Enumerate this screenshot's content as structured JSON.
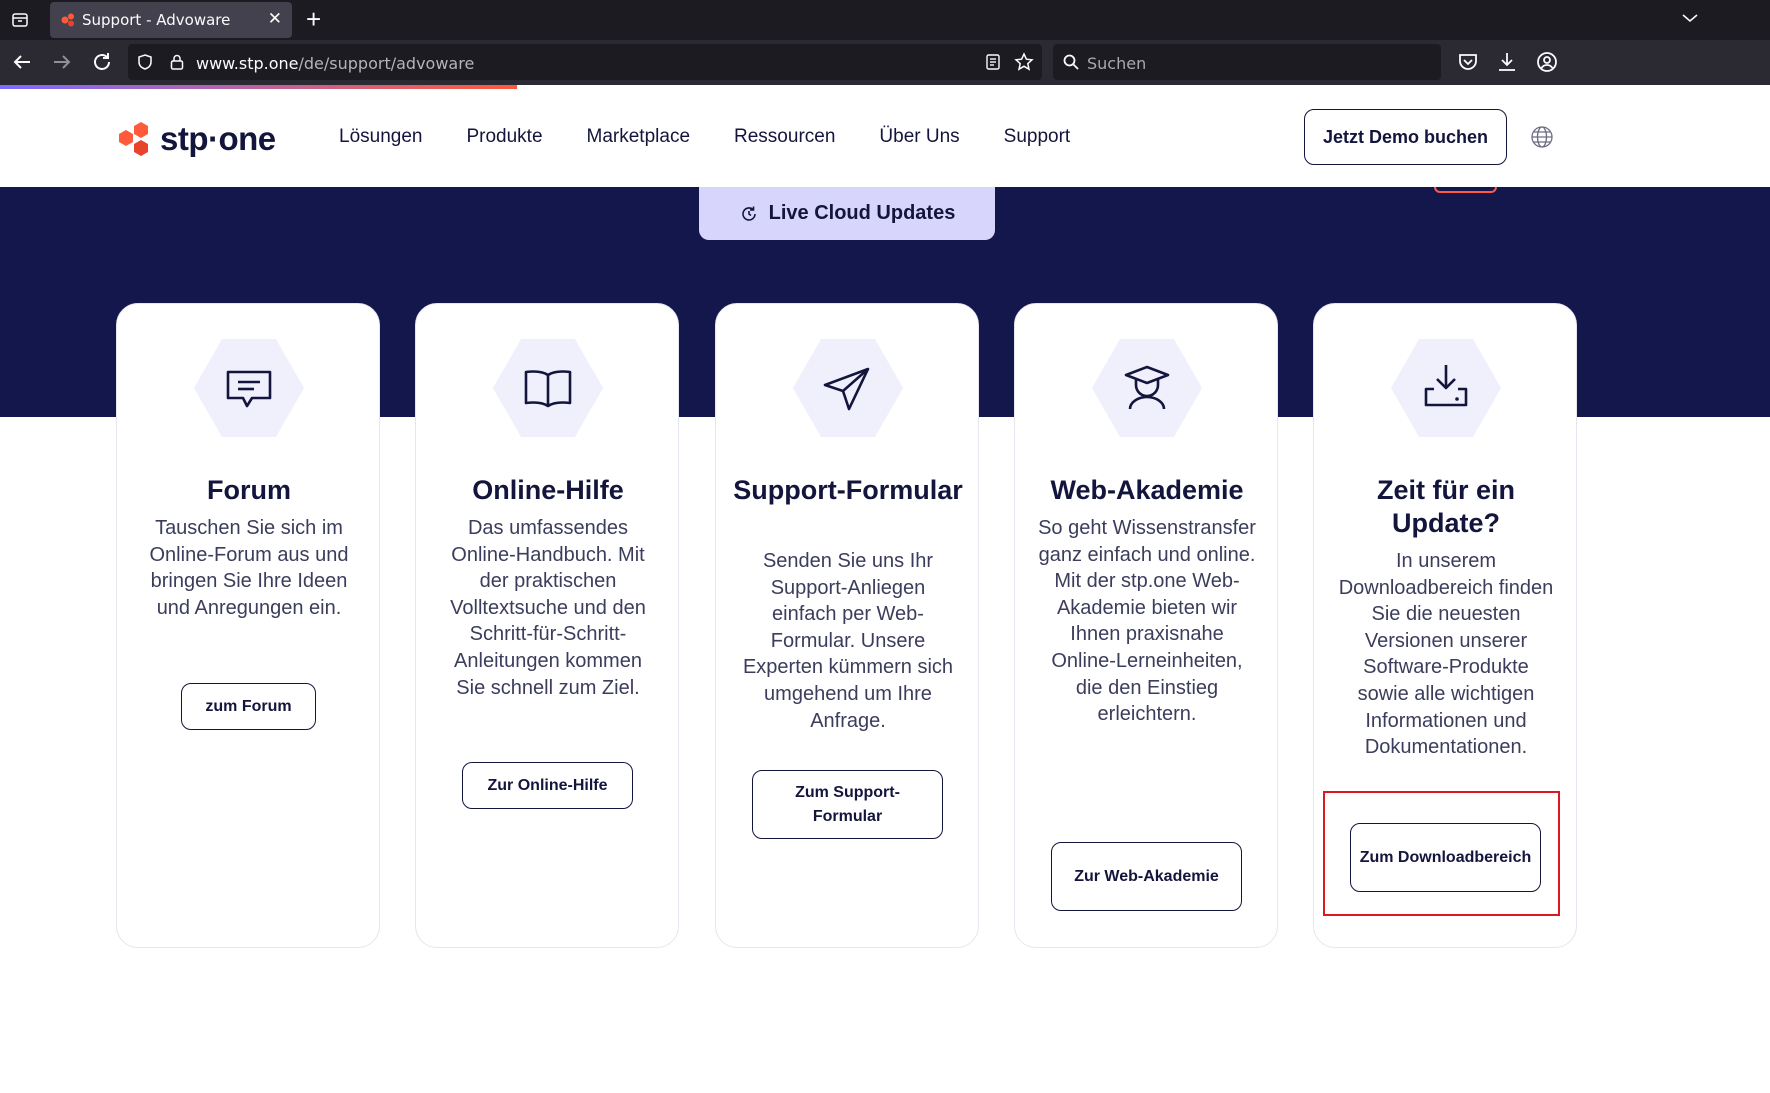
{
  "browser": {
    "tab_title": "Support - Advoware",
    "url_host": "www.stp.one",
    "url_path": "/de/support/advoware",
    "search_placeholder": "Suchen"
  },
  "header": {
    "logo_text": "stp·one",
    "menu": [
      "Lösungen",
      "Produkte",
      "Marketplace",
      "Ressourcen",
      "Über Uns",
      "Support"
    ],
    "demo_button": "Jetzt Demo buchen"
  },
  "hero": {
    "live_updates_label": "Live Cloud Updates"
  },
  "cards": [
    {
      "icon": "chat-icon",
      "title": "Forum",
      "description": "Tauschen Sie sich im Online-Forum aus und bringen Sie Ihre Ideen und Anregungen ein.",
      "button": "zum Forum"
    },
    {
      "icon": "book-icon",
      "title": "Online-Hilfe",
      "description": "Das umfassendes Online-Handbuch. Mit der praktischen Volltextsuche und den Schritt-für-Schritt-Anleitungen kommen Sie schnell zum Ziel.",
      "button": "Zur Online-Hilfe"
    },
    {
      "icon": "paper-plane-icon",
      "title": "Support-Formular",
      "description": "Senden Sie uns Ihr Support-Anliegen einfach per Web-Formular. Unsere Experten kümmern sich umgehend um Ihre Anfrage.",
      "button": "Zum Support-Formular"
    },
    {
      "icon": "graduation-cap-icon",
      "title": "Web-Akademie",
      "description": "So geht Wissenstransfer ganz einfach und online. Mit der stp.one Web-Akademie bieten wir Ihnen praxisnahe Online-Lerneinheiten, die den Einstieg erleichtern.",
      "button": "Zur Web-Akademie"
    },
    {
      "icon": "download-icon",
      "title": "Zeit für ein Update?",
      "description": "In unserem Downloadbereich finden Sie die neuesten Versionen unserer Software-Produkte sowie alle wichtigen Informationen und Dokumentationen.",
      "button": "Zum Downloadbereich"
    }
  ],
  "colors": {
    "navy": "#13153c",
    "hero_bg": "#13174b",
    "accent_orange": "#ff5a3c",
    "lavender": "#d7d5fb",
    "highlight_red": "#e0161e"
  }
}
